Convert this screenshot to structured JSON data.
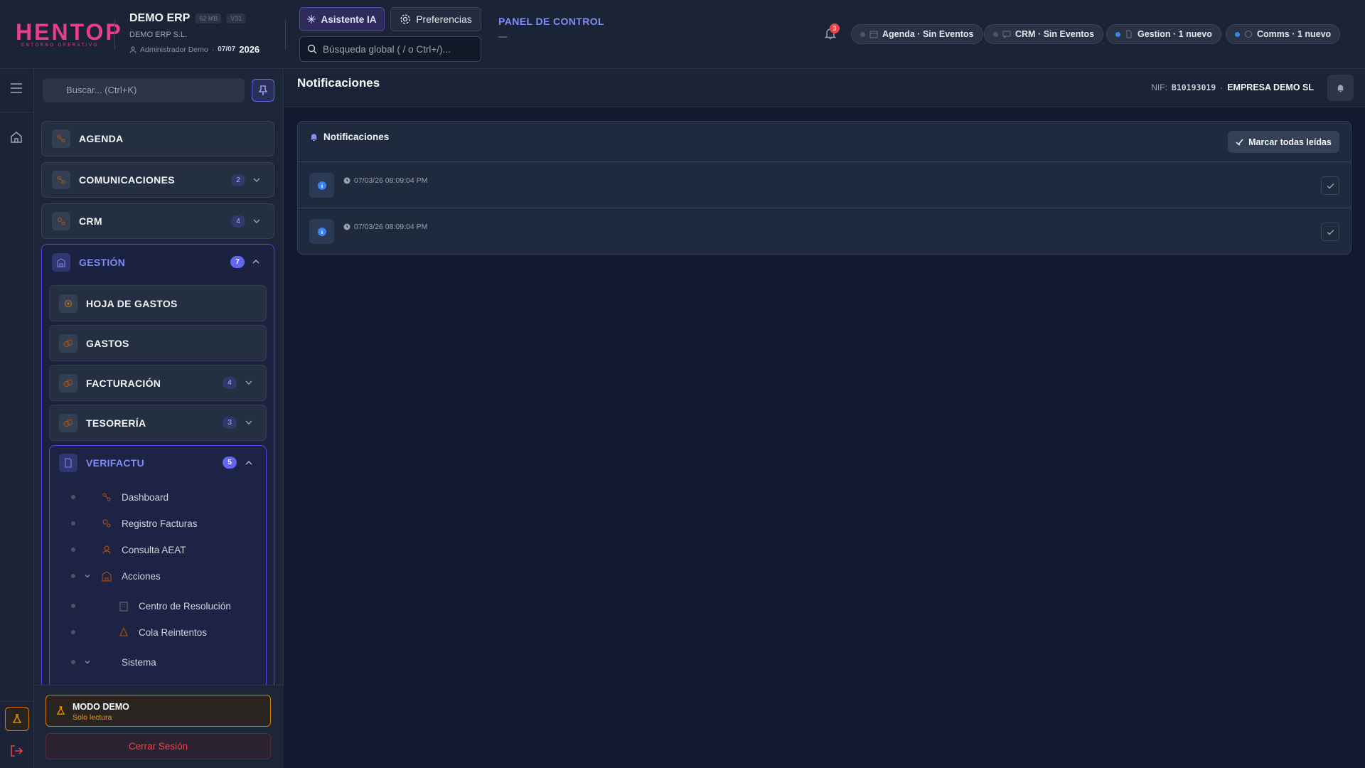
{
  "brand": {
    "logo": "HENTOP",
    "logo_sub": "ENTORNO OPERATIVO",
    "app_name": "DEMO ERP",
    "size_badge": "62 MB",
    "version_badge": "V31",
    "company": "DEMO ERP S.L.",
    "user": "Administrador Demo",
    "sep": "·",
    "date": "07/07",
    "year": "2026"
  },
  "header": {
    "ai_button": "Asistente IA",
    "prefs_button": "Preferencias",
    "search_placeholder": "Búsqueda global ( / o Ctrl+/)...",
    "panel_title": "PANEL DE CONTROL",
    "panel_dash": "—",
    "notif_count": "3",
    "pills": [
      {
        "label": "Agenda · Sin Eventos",
        "dot": "#4b5563"
      },
      {
        "label": "CRM · Sin Eventos",
        "dot": "#4b5563"
      },
      {
        "label": "Gestion · 1 nuevo",
        "dot": "#3b82f6"
      },
      {
        "label": "Comms · 1 nuevo",
        "dot": "#3b82f6"
      }
    ]
  },
  "sidebar": {
    "search_placeholder": "Buscar... (Ctrl+K)",
    "items": [
      {
        "label": "AGENDA",
        "count": ""
      },
      {
        "label": "COMUNICACIONES",
        "count": "2"
      },
      {
        "label": "CRM",
        "count": "4"
      }
    ],
    "gestion": {
      "label": "GESTIÓN",
      "count": "7",
      "subitems": [
        {
          "label": "HOJA DE GASTOS",
          "count": ""
        },
        {
          "label": "GASTOS",
          "count": ""
        },
        {
          "label": "FACTURACIÓN",
          "count": "4"
        },
        {
          "label": "TESORERÍA",
          "count": "3"
        }
      ],
      "verifactu": {
        "label": "VERIFACTU",
        "count": "5",
        "leaves": [
          "Dashboard",
          "Registro Facturas",
          "Consulta AEAT",
          "Acciones",
          "Centro de Resolución",
          "Cola Reintentos",
          "Sistema"
        ]
      }
    },
    "demo_title": "MODO DEMO",
    "demo_sub": "Solo lectura",
    "logout": "Cerrar Sesión"
  },
  "main": {
    "page_title": "Notificaciones",
    "nif_label": "NIF:",
    "nif_value": "B10193019",
    "nif_sep": "·",
    "company": "EMPRESA DEMO SL",
    "card_title": "Notificaciones",
    "mark_all": "Marcar todas leídas",
    "notifications": [
      {
        "time": "07/03/26 08:09:04 PM"
      },
      {
        "time": "07/03/26 08:09:04 PM"
      }
    ]
  },
  "colors": {
    "accent": "#6366f1",
    "brand": "#e83e8c",
    "warning": "#d97706",
    "danger": "#ef4444"
  }
}
